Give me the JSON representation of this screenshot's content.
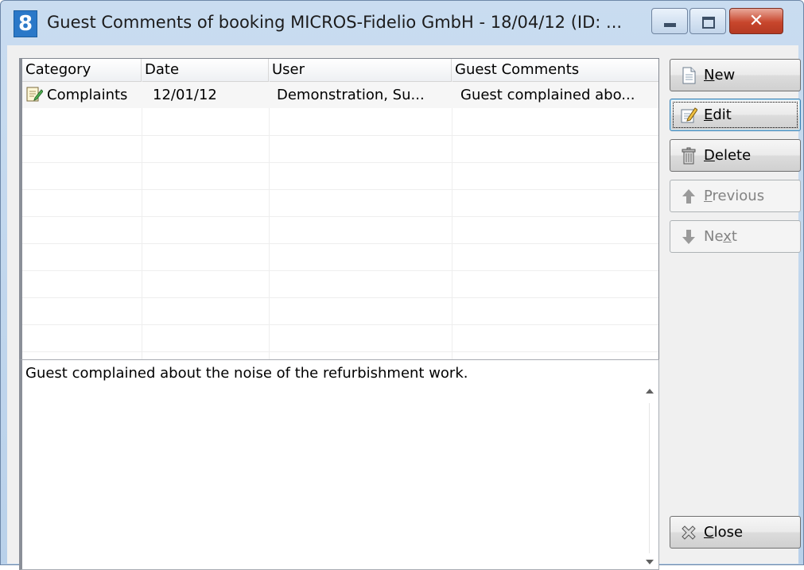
{
  "window": {
    "title": "Guest Comments of booking MICROS-Fidelio GmbH - 18/04/12 (ID: ...",
    "app_icon": "8"
  },
  "grid": {
    "columns": [
      "Category",
      "Date",
      "User",
      "Guest Comments"
    ],
    "rows": [
      {
        "category": "Complaints",
        "date": "12/01/12",
        "user": "Demonstration, Su...",
        "comment": "Guest complained abo..."
      }
    ]
  },
  "memo": {
    "text": "Guest complained about the noise of the refurbishment work."
  },
  "buttons": {
    "new": {
      "underline": "N",
      "rest": "ew"
    },
    "edit": {
      "underline": "E",
      "rest": "dit"
    },
    "delete": {
      "underline": "D",
      "rest": "elete"
    },
    "previous": {
      "underline": "P",
      "rest": "revious"
    },
    "next": {
      "pre": "Ne",
      "underline": "x",
      "rest": "t"
    },
    "close": {
      "underline": "C",
      "rest": "lose"
    }
  }
}
